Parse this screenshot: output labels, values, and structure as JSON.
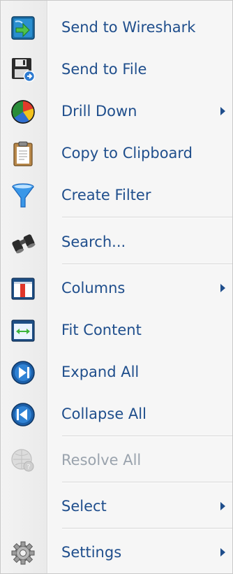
{
  "menu": {
    "items": [
      {
        "label": "Send to Wireshark",
        "icon": "wireshark-icon"
      },
      {
        "label": "Send to File",
        "icon": "save-to-file-icon"
      },
      {
        "label": "Drill Down",
        "icon": "drill-down-chart-icon",
        "submenu": true
      },
      {
        "label": "Copy to Clipboard",
        "icon": "clipboard-icon"
      },
      {
        "label": "Create Filter",
        "icon": "filter-funnel-icon"
      },
      {
        "label": "Search...",
        "icon": "binoculars-icon"
      },
      {
        "label": "Columns",
        "icon": "columns-icon",
        "submenu": true
      },
      {
        "label": "Fit Content",
        "icon": "fit-content-icon"
      },
      {
        "label": "Expand All",
        "icon": "expand-all-icon"
      },
      {
        "label": "Collapse All",
        "icon": "collapse-all-icon"
      },
      {
        "label": "Resolve All",
        "icon": "resolve-all-icon",
        "disabled": true
      },
      {
        "label": "Select",
        "submenu": true
      },
      {
        "label": "Settings",
        "icon": "gear-icon",
        "submenu": true
      }
    ]
  },
  "colors": {
    "label": "#1f4e8c",
    "disabled_label": "#9aa3ad",
    "background": "#f6f6f6"
  }
}
